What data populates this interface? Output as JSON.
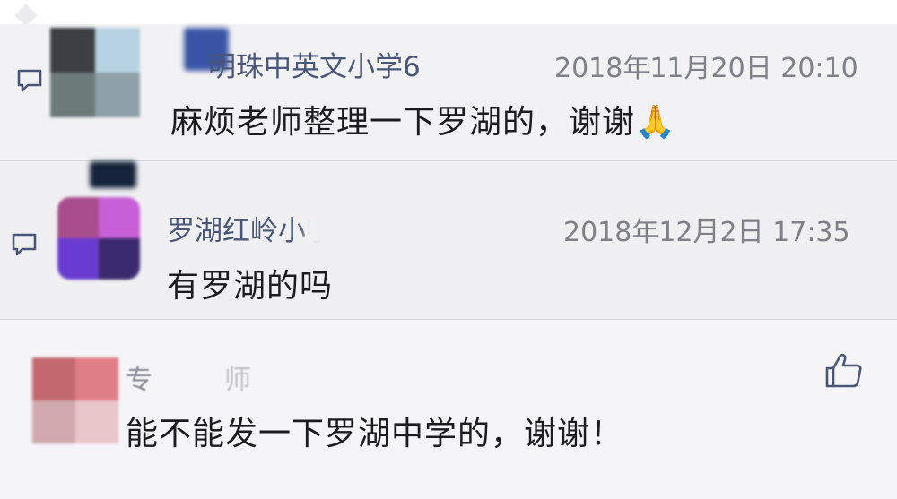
{
  "comments": [
    {
      "name": "明珠中英文小学6",
      "time": "2018年11月20日 20:10",
      "text": "麻烦老师整理一下罗湖的，谢谢",
      "emoji": "🙏"
    },
    {
      "name": "罗湖红岭小学",
      "time": "2018年12月2日 17:35",
      "text": "有罗湖的吗"
    },
    {
      "name": "专",
      "name_tail": "师",
      "text": "能不能发一下罗湖中学的，谢谢！"
    }
  ],
  "colors": {
    "name": "#4a5678",
    "time": "#7f8088",
    "text": "#1c1c1e",
    "icon": "#4a5678"
  },
  "icons": {
    "reply": "comment-icon",
    "like": "thumbs-up-icon"
  }
}
